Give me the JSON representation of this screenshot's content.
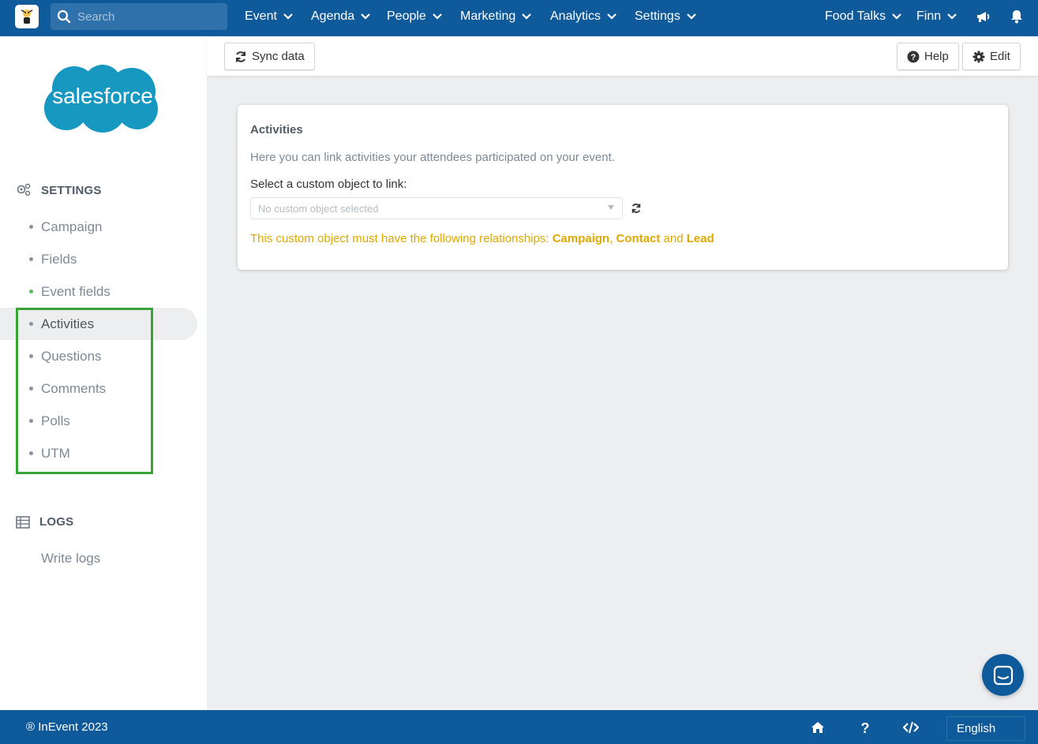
{
  "topbar": {
    "search_placeholder": "Search",
    "nav": [
      {
        "label": "Event"
      },
      {
        "label": "Agenda"
      },
      {
        "label": "People"
      },
      {
        "label": "Marketing"
      },
      {
        "label": "Analytics"
      },
      {
        "label": "Settings"
      },
      {
        "label": "Food Talks"
      },
      {
        "label": "Finn"
      }
    ],
    "icons": [
      "megaphone-icon",
      "bell-icon"
    ]
  },
  "sidebar": {
    "logo_text": "salesforce",
    "settings_heading": "SETTINGS",
    "items": [
      {
        "label": "Campaign",
        "dot_color": "#8a949d"
      },
      {
        "label": "Fields",
        "dot_color": "#8a949d"
      },
      {
        "label": "Event fields",
        "dot_color": "#5cb85c"
      },
      {
        "label": "Activities",
        "dot_color": "#8a949d",
        "active": true
      },
      {
        "label": "Questions",
        "dot_color": "#8a949d"
      },
      {
        "label": "Comments",
        "dot_color": "#8a949d"
      },
      {
        "label": "Polls",
        "dot_color": "#8a949d"
      },
      {
        "label": "UTM",
        "dot_color": "#8a949d"
      }
    ],
    "logs_heading": "LOGS",
    "logs_items": [
      {
        "label": "Write logs"
      }
    ]
  },
  "toolbar": {
    "sync_label": "Sync data",
    "help_label": "Help",
    "edit_label": "Edit"
  },
  "card": {
    "title": "Activities",
    "description": "Here you can link activities your attendees participated on your event.",
    "select_label": "Select a custom object to link:",
    "select_placeholder": "No custom object selected",
    "warning_prefix": "This custom object must have the following relationships: ",
    "rel_1": "Campaign",
    "sep_1": ", ",
    "rel_2": "Contact",
    "sep_2": " and ",
    "rel_3": "Lead"
  },
  "footer": {
    "copyright": "® InEvent 2023",
    "language": "English",
    "icons": [
      "home-icon",
      "question-icon",
      "code-icon"
    ]
  },
  "colors": {
    "brand_blue": "#0f5a9a",
    "highlight_green": "#3aa335",
    "warning_yellow": "#e0a800",
    "salesforce_blue": "#1798c1"
  }
}
